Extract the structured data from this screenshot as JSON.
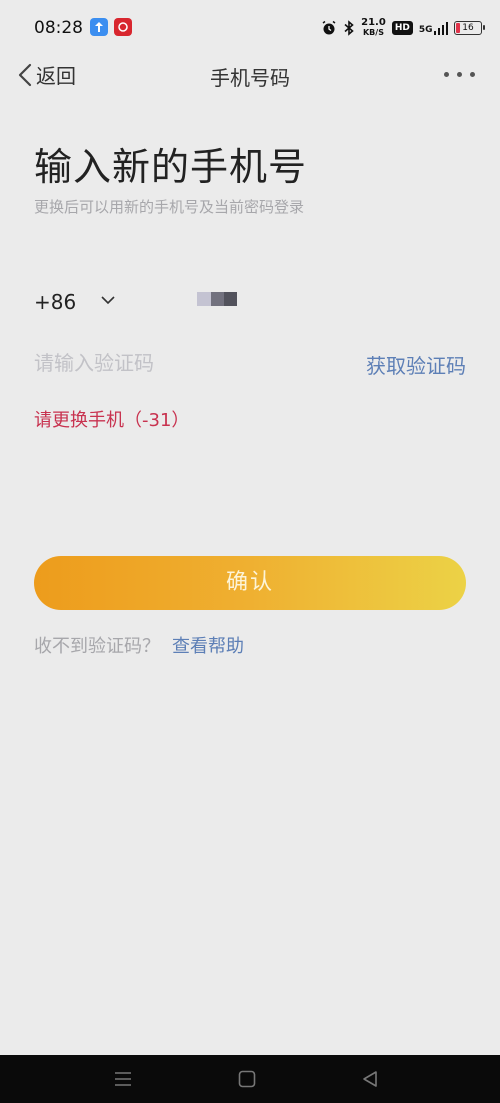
{
  "status_bar": {
    "time": "08:28",
    "net_speed_value": "21.0",
    "net_speed_unit": "KB/S",
    "hd": "HD",
    "network": "5G",
    "battery": "16",
    "battery_color": "#e0334a"
  },
  "nav": {
    "back_label": "返回",
    "title": "手机号码"
  },
  "heading": "输入新的手机号",
  "subheading": "更换后可以用新的手机号及当前密码登录",
  "phone": {
    "country_code": "+86"
  },
  "code": {
    "placeholder": "请输入验证码",
    "get_code_label": "获取验证码"
  },
  "error": "请更换手机（-31）",
  "confirm_label": "确认",
  "help": {
    "question": "收不到验证码？",
    "link": "查看帮助"
  },
  "colors": {
    "accent_link": "#5d7fb6",
    "error": "#c8324f",
    "button_start": "#ed9c1c",
    "button_end": "#ecd246"
  }
}
